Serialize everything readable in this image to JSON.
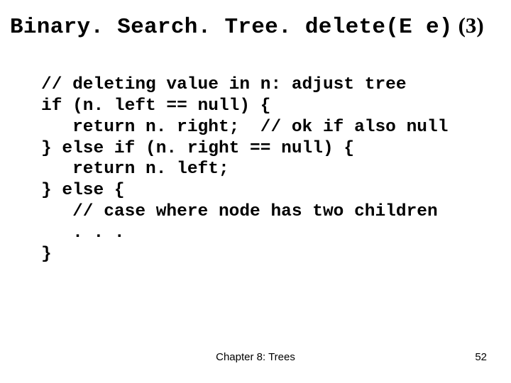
{
  "title": {
    "mono": "Binary. Search. Tree. delete(E e)",
    "serif": " (3)"
  },
  "code": {
    "lines": [
      "// deleting value in n: adjust tree",
      "if (n. left == null) {",
      "   return n. right;  // ok if also null",
      "} else if (n. right == null) {",
      "   return n. left;",
      "} else {",
      "   // case where node has two children",
      "   . . .",
      "}"
    ]
  },
  "footer": {
    "center": "Chapter 8: Trees",
    "page": "52"
  }
}
